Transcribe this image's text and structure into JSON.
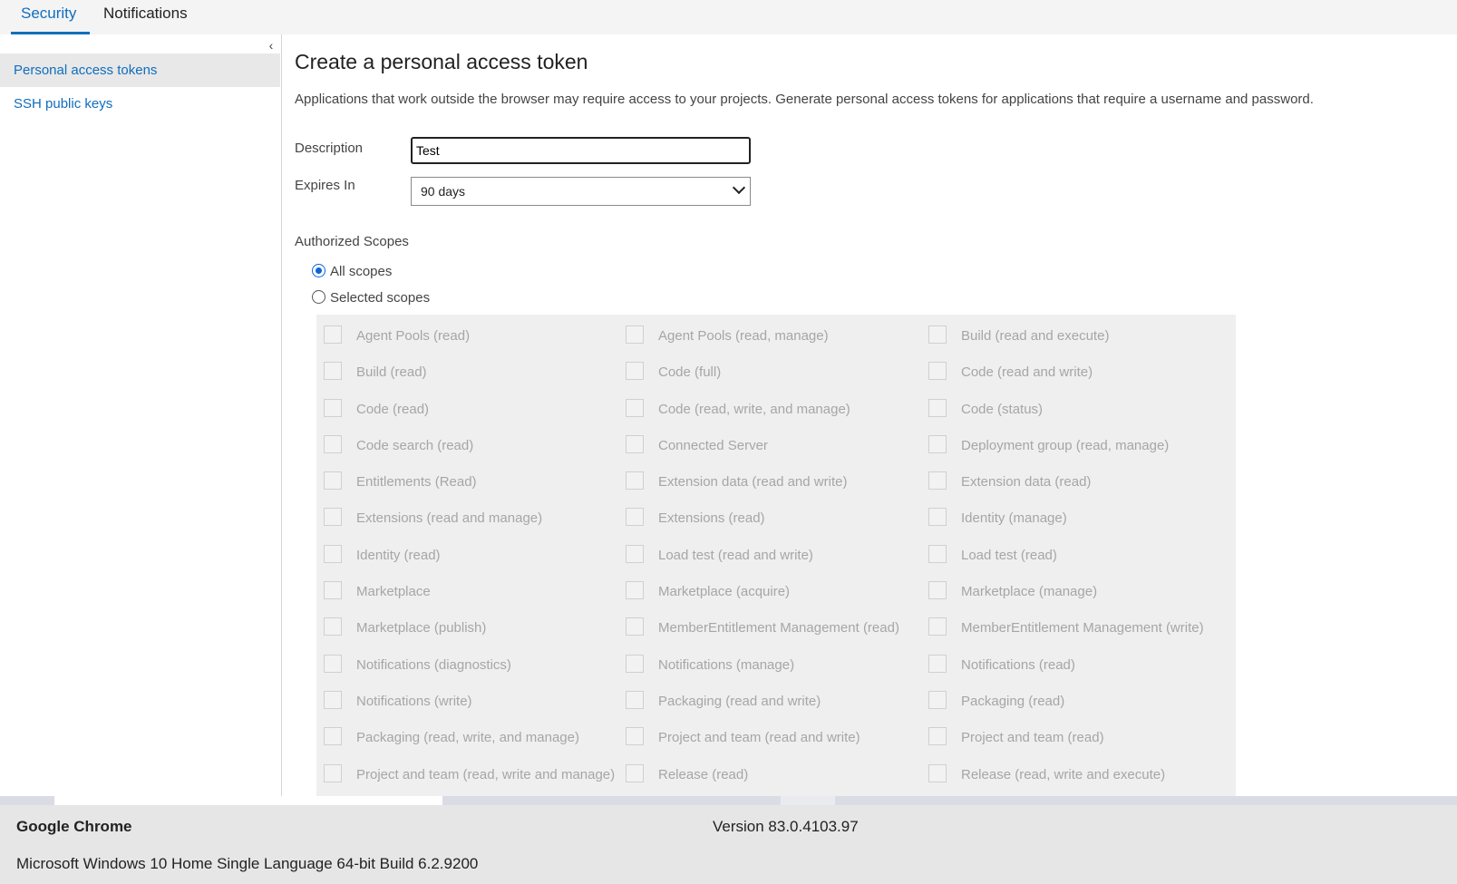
{
  "tabs": [
    {
      "label": "Security",
      "active": true
    },
    {
      "label": "Notifications",
      "active": false
    }
  ],
  "sidebar": {
    "collapse_icon": "chevron-left-icon",
    "items": [
      {
        "label": "Personal access tokens",
        "selected": true
      },
      {
        "label": "SSH public keys",
        "selected": false
      }
    ]
  },
  "main": {
    "title": "Create a personal access token",
    "description": "Applications that work outside the browser may require access to your projects. Generate personal access tokens for applications that require a username and password.",
    "form": {
      "description_label": "Description",
      "description_value": "Test",
      "expires_label": "Expires In",
      "expires_value": "90 days"
    },
    "scopes": {
      "label": "Authorized Scopes",
      "radio_all": "All scopes",
      "radio_selected": "Selected scopes",
      "selected_option": "All scopes",
      "items": [
        "Agent Pools (read)",
        "Agent Pools (read, manage)",
        "Build (read and execute)",
        "Build (read)",
        "Code (full)",
        "Code (read and write)",
        "Code (read)",
        "Code (read, write, and manage)",
        "Code (status)",
        "Code search (read)",
        "Connected Server",
        "Deployment group (read, manage)",
        "Entitlements (Read)",
        "Extension data (read and write)",
        "Extension data (read)",
        "Extensions (read and manage)",
        "Extensions (read)",
        "Identity (manage)",
        "Identity (read)",
        "Load test (read and write)",
        "Load test (read)",
        "Marketplace",
        "Marketplace (acquire)",
        "Marketplace (manage)",
        "Marketplace (publish)",
        "MemberEntitlement Management (read)",
        "MemberEntitlement Management (write)",
        "Notifications (diagnostics)",
        "Notifications (manage)",
        "Notifications (read)",
        "Notifications (write)",
        "Packaging (read and write)",
        "Packaging (read)",
        "Packaging (read, write, and manage)",
        "Project and team (read and write)",
        "Project and team (read)",
        "Project and team (read, write and manage)",
        "Release (read)",
        "Release (read, write and execute)"
      ]
    }
  },
  "footer": {
    "app_name": "Google Chrome",
    "version": "Version 83.0.4103.97",
    "os_info": "Microsoft Windows 10 Home Single Language 64-bit Build 6.2.9200"
  }
}
